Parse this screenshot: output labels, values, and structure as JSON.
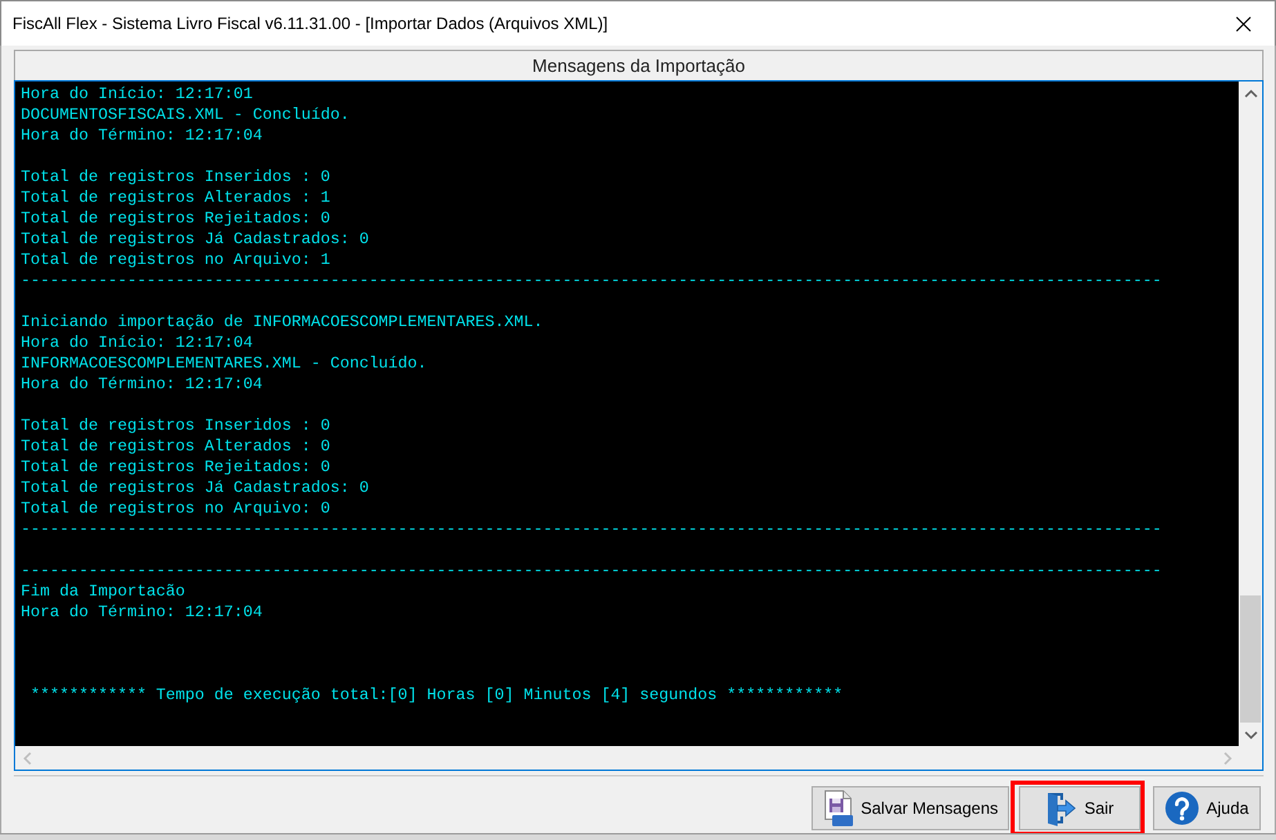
{
  "window": {
    "title": "FiscAll Flex - Sistema Livro Fiscal v6.11.31.00 - [Importar Dados (Arquivos XML)]"
  },
  "panel": {
    "title": "Mensagens da Importação"
  },
  "console": {
    "lines": [
      {
        "kind": "text",
        "text": "Hora do Início: 12:17:01"
      },
      {
        "kind": "text",
        "text": "DOCUMENTOSFISCAIS.XML - Concluído."
      },
      {
        "kind": "text",
        "text": "Hora do Término: 12:17:04"
      },
      {
        "kind": "blank"
      },
      {
        "kind": "text",
        "text": "Total de registros Inseridos : 0"
      },
      {
        "kind": "text",
        "text": "Total de registros Alterados : 1"
      },
      {
        "kind": "text",
        "text": "Total de registros Rejeitados: 0"
      },
      {
        "kind": "text",
        "text": "Total de registros Já Cadastrados: 0"
      },
      {
        "kind": "text",
        "text": "Total de registros no Arquivo: 1"
      },
      {
        "kind": "rule",
        "text": "----------------------------------------------------------------------------------------------------------------------"
      },
      {
        "kind": "blank"
      },
      {
        "kind": "text",
        "text": "Iniciando importação de INFORMACOESCOMPLEMENTARES.XML."
      },
      {
        "kind": "text",
        "text": "Hora do Início: 12:17:04"
      },
      {
        "kind": "text",
        "text": "INFORMACOESCOMPLEMENTARES.XML - Concluído."
      },
      {
        "kind": "text",
        "text": "Hora do Término: 12:17:04"
      },
      {
        "kind": "blank"
      },
      {
        "kind": "text",
        "text": "Total de registros Inseridos : 0"
      },
      {
        "kind": "text",
        "text": "Total de registros Alterados : 0"
      },
      {
        "kind": "text",
        "text": "Total de registros Rejeitados: 0"
      },
      {
        "kind": "text",
        "text": "Total de registros Já Cadastrados: 0"
      },
      {
        "kind": "text",
        "text": "Total de registros no Arquivo: 0"
      },
      {
        "kind": "rule",
        "text": "----------------------------------------------------------------------------------------------------------------------"
      },
      {
        "kind": "blank"
      },
      {
        "kind": "rule",
        "text": "----------------------------------------------------------------------------------------------------------------------"
      },
      {
        "kind": "text",
        "text": "Fim da Importacão"
      },
      {
        "kind": "text",
        "text": "Hora do Término: 12:17:04"
      },
      {
        "kind": "blank"
      },
      {
        "kind": "blank"
      },
      {
        "kind": "blank"
      },
      {
        "kind": "text",
        "text": " ************ Tempo de execução total:[0] Horas [0] Minutos [4] segundos ************"
      }
    ]
  },
  "buttons": [
    {
      "kind": "save-log",
      "label": "Salvar Mensagens",
      "highlighted": false
    },
    {
      "kind": "exit",
      "label": "Sair",
      "highlighted": true
    },
    {
      "kind": "help",
      "label": "Ajuda",
      "highlighted": false
    }
  ]
}
